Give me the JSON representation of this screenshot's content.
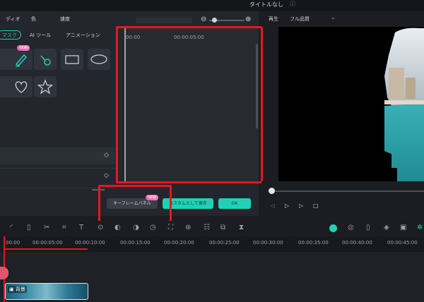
{
  "window": {
    "title": "タイトルなし"
  },
  "top_menu": [
    "ディオ",
    "色",
    "速度"
  ],
  "tabs": [
    {
      "label": "マスク",
      "active": true
    },
    {
      "label": "AI ツール"
    },
    {
      "label": "アニメーション"
    }
  ],
  "mask_shapes": [
    "pen",
    "paintbrush",
    "rectangle",
    "ellipse",
    "heart",
    "star"
  ],
  "new_badge": "NEW",
  "keyframe_times": {
    "start": "00:00",
    "mid": "00:00:05:00"
  },
  "buttons": {
    "keyframe_panel": "キーフレームパネル",
    "save_custom": "カスタムとして保存",
    "ok": "OK"
  },
  "preview": {
    "label": "再生",
    "quality": "フル品質"
  },
  "timeline": {
    "ticks": [
      "00:00",
      "00:00:05:00",
      "00:00:10:00",
      "00:00:15:00",
      "00:00:20:00",
      "00:00:25:00",
      "00:00:30:00",
      "00:00:35:00",
      "00:00:40:00",
      "00:00:45:00"
    ],
    "clip_label": "背景"
  },
  "colors": {
    "accent": "#1fd2b7",
    "highlight_red": "#e2191d",
    "badge_pink": "#e45eb9"
  }
}
